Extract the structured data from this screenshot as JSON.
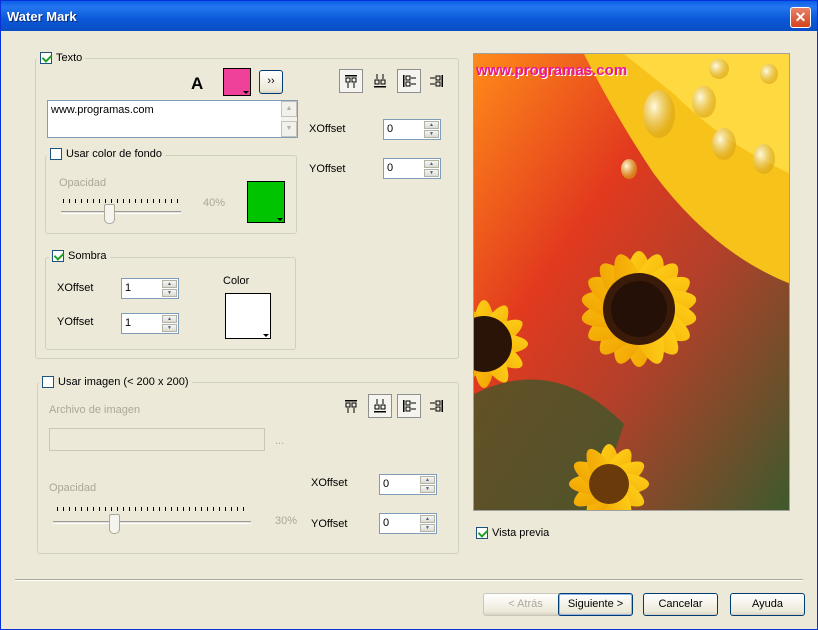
{
  "window": {
    "title": "Water Mark",
    "close_glyph": "✕"
  },
  "text_group": {
    "label": "Texto",
    "checked": true,
    "font_glyph": "A",
    "color": "#f0419a",
    "more_label": "››",
    "text_value": "www.programas.com",
    "xoffset_label": "XOffset",
    "xoffset_value": "0",
    "yoffset_label": "YOffset",
    "yoffset_value": "0",
    "bg": {
      "label": "Usar color de fondo",
      "checked": false,
      "opacity_label": "Opacidad",
      "opacity_percent": "40%",
      "opacity_fraction": 0.4,
      "color": "#00c400"
    },
    "shadow": {
      "label": "Sombra",
      "checked": true,
      "xoffset_label": "XOffset",
      "xoffset_value": "1",
      "yoffset_label": "YOffset",
      "yoffset_value": "1",
      "color_label": "Color",
      "color": "#ffffff"
    }
  },
  "image_group": {
    "label": "Usar imagen (< 200 x 200)",
    "checked": false,
    "file_label": "Archivo de imagen",
    "browse_label": "...",
    "opacity_label": "Opacidad",
    "opacity_percent": "30%",
    "opacity_fraction": 0.3,
    "xoffset_label": "XOffset",
    "xoffset_value": "0",
    "yoffset_label": "YOffset",
    "yoffset_value": "0"
  },
  "preview": {
    "watermark_text": "www.programas.com",
    "checkbox_label": "Vista previa",
    "checked": true
  },
  "buttons": {
    "back": "< Atrás",
    "next": "Siguiente >",
    "cancel": "Cancelar",
    "help": "Ayuda"
  }
}
